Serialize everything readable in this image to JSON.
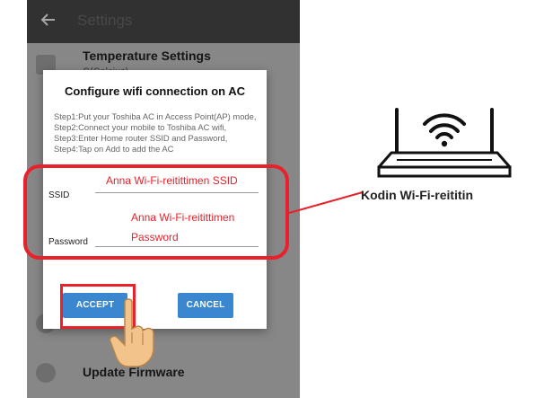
{
  "app": {
    "title": "Settings",
    "rows": [
      {
        "title": "Temperature Settings",
        "subtitle": "C(Celcius)"
      },
      {
        "title": "Update Firmware"
      }
    ]
  },
  "dialog": {
    "title": "Configure wifi connection on AC",
    "steps": "Step1:Put your Toshiba AC in Access Point(AP) mode, Step2:Connect your mobile to Toshiba AC wifi, Step3:Enter Home router SSID and Password, Step4:Tap on Add to add the AC",
    "ssid_label": "SSID",
    "password_label": "Password",
    "accept_label": "ACCEPT",
    "cancel_label": "CANCEL"
  },
  "annotations": {
    "ssid_hint": "Anna Wi-Fi-reitittimen SSID",
    "password_hint_line1": "Anna Wi-Fi-reitittimen",
    "password_hint_line2": "Password",
    "router_label": "Kodin Wi-Fi-reititin"
  },
  "colors": {
    "highlight": "#e8212a",
    "button": "#3a86cf",
    "appbar": "#4c4c4c"
  },
  "icons": [
    "back-arrow-icon",
    "thermometer-icon",
    "info-icon",
    "wifi-icon",
    "router-icon",
    "pointing-hand-icon"
  ]
}
